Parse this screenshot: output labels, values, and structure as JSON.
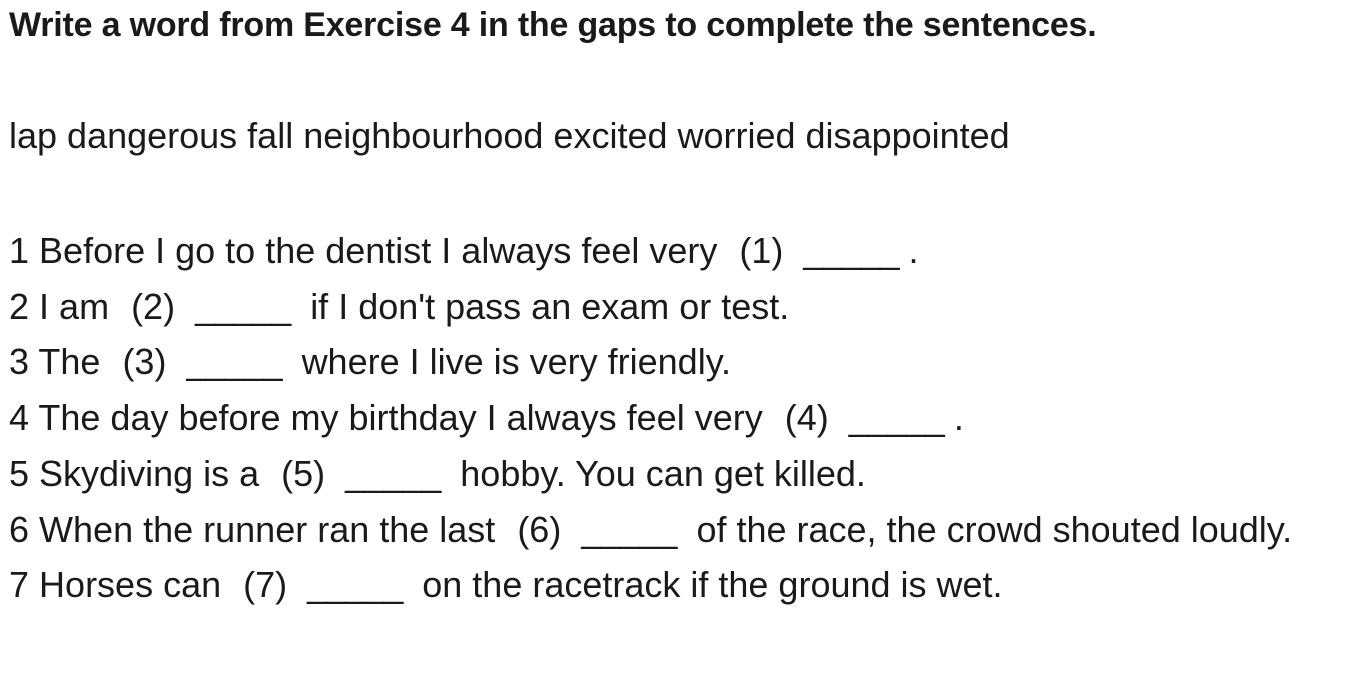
{
  "title": "Write a word from Exercise 4 in the gaps to complete the sentences.",
  "word_bank": "lap dangerous fall neighbourhood excited worried disappointed",
  "sentences": [
    {
      "num": "1",
      "before": "Before I go to the dentist I always feel very",
      "gap": "(1)",
      "blank": "_____",
      "after": "."
    },
    {
      "num": "2",
      "before": "I am",
      "gap": "(2)",
      "blank": "_____",
      "after": "if I don't pass an exam or test."
    },
    {
      "num": "3",
      "before": "The",
      "gap": "(3)",
      "blank": "_____",
      "after": "where I live is very friendly."
    },
    {
      "num": "4",
      "before": "The day before my birthday I always feel very",
      "gap": "(4)",
      "blank": "_____",
      "after": "."
    },
    {
      "num": "5",
      "before": "Skydiving is a",
      "gap": "(5)",
      "blank": "_____",
      "after": "hobby. You can get killed."
    },
    {
      "num": "6",
      "before": "When the runner ran the last",
      "gap": "(6)",
      "blank": "_____",
      "after": "of the race, the crowd shouted loudly."
    },
    {
      "num": "7",
      "before": "Horses can",
      "gap": "(7)",
      "blank": "_____",
      "after": "on the racetrack if the ground is wet."
    }
  ]
}
